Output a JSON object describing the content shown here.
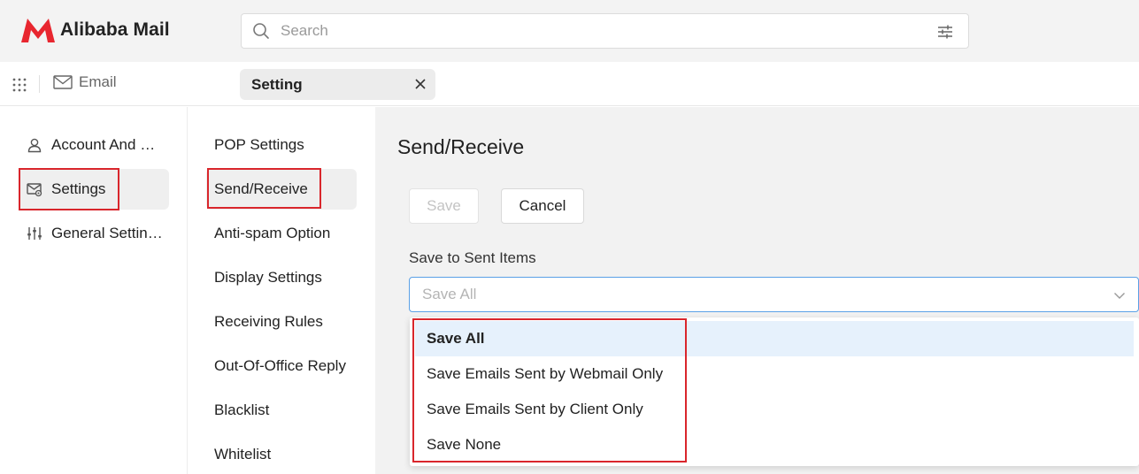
{
  "app": {
    "name": "Alibaba Mail",
    "brand_color": "#e8262f"
  },
  "search": {
    "placeholder": "Search"
  },
  "tabs": {
    "email_label": "Email",
    "setting_label": "Setting"
  },
  "sidebar": {
    "items": [
      {
        "label": "Account And Security",
        "icon": "user-icon"
      },
      {
        "label": "Settings",
        "icon": "mail-settings-icon",
        "active": true
      },
      {
        "label": "General Settings",
        "icon": "sliders-icon"
      }
    ]
  },
  "subnav": {
    "items": [
      {
        "label": "POP Settings"
      },
      {
        "label": "Send/Receive",
        "active": true
      },
      {
        "label": "Anti-spam Option"
      },
      {
        "label": "Display Settings"
      },
      {
        "label": "Receiving Rules"
      },
      {
        "label": "Out-Of-Office Reply"
      },
      {
        "label": "Blacklist"
      },
      {
        "label": "Whitelist"
      }
    ]
  },
  "main": {
    "title": "Send/Receive",
    "save_label": "Save",
    "cancel_label": "Cancel",
    "field_label": "Save to Sent Items",
    "select_value": "Save All",
    "options": [
      "Save All",
      "Save Emails Sent by Webmail Only",
      "Save Emails Sent by Client Only",
      "Save None"
    ]
  },
  "colors": {
    "highlight": "#d9262c",
    "select_border": "#5aa0e6",
    "selected_option_bg": "#e6f1fc"
  }
}
